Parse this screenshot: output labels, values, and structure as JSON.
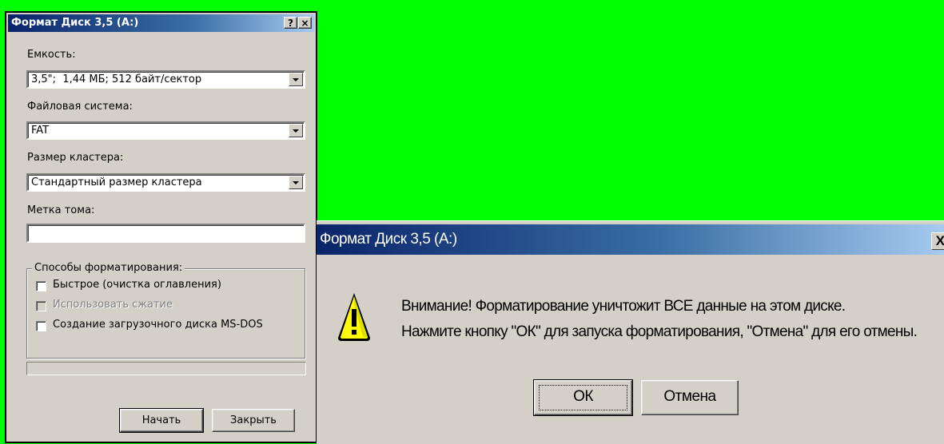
{
  "format_dialog": {
    "title": "Формат Диск 3,5 (A:)",
    "help_button": "?",
    "close_button": "×",
    "capacity_label": "Емкость:",
    "capacity_value": "3,5\";  1,44 МБ; 512 байт/сектор",
    "filesystem_label": "Файловая система:",
    "filesystem_value": "FAT",
    "cluster_label": "Размер кластера:",
    "cluster_value": "Стандартный размер кластера",
    "volume_label": "Метка тома:",
    "volume_value": "",
    "options_group": "Способы форматирования:",
    "options": [
      {
        "label": "Быстрое (очистка оглавления)",
        "checked": false,
        "enabled": true
      },
      {
        "label": "Использовать сжатие",
        "checked": false,
        "enabled": false
      },
      {
        "label": "Создание загрузочного диска MS-DOS",
        "checked": false,
        "enabled": true
      }
    ],
    "progress": 0,
    "start_button": "Начать",
    "close_label": "Закрыть"
  },
  "warning_dialog": {
    "title": "Формат Диск 3,5 (A:)",
    "close_button": "X",
    "icon": "warning-icon",
    "message_line1": "Внимание! Форматирование уничтожит ВСЕ данные на этом диске.",
    "message_line2": "Нажмите кнопку \"ОК\" для запуска форматирования, \"Отмена\" для его отмены.",
    "ok_button": "ОК",
    "cancel_button": "Отмена"
  },
  "colors": {
    "background": "#00ff00",
    "title_start": "#0a246a",
    "title_end": "#a6caf0",
    "face": "#d4d0c8"
  }
}
